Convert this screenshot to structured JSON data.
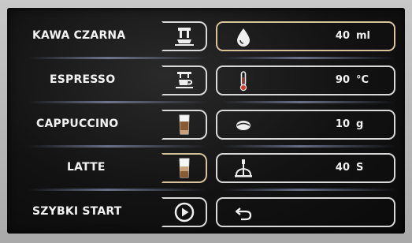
{
  "menu": {
    "items": [
      {
        "label": "KAWA CZARNA",
        "icon": "black-coffee-cup-icon",
        "active": false
      },
      {
        "label": "ESPRESSO",
        "icon": "espresso-cup-icon",
        "active": false
      },
      {
        "label": "CAPPUCCINO",
        "icon": "cappuccino-glass-icon",
        "active": false
      },
      {
        "label": "LATTE",
        "icon": "latte-glass-icon",
        "active": true
      },
      {
        "label": "SZYBKI START",
        "icon": "play-icon",
        "active": false
      }
    ]
  },
  "params": {
    "water": {
      "icon": "water-drop-icon",
      "value": "40",
      "unit": "ml",
      "active": true
    },
    "temperature": {
      "icon": "thermometer-icon",
      "value": "90",
      "unit": "°C",
      "active": false
    },
    "coffee": {
      "icon": "coffee-bean-icon",
      "value": "10",
      "unit": "g",
      "active": false
    },
    "pressure": {
      "icon": "brewing-time-icon",
      "value": "40",
      "unit": "S",
      "active": false
    },
    "back": {
      "icon": "back-arrow-icon"
    }
  },
  "colors": {
    "active_border": "#d6c39a",
    "border": "#d9d9d9",
    "text": "#f2f2f2",
    "screen_bg": "#121212"
  }
}
